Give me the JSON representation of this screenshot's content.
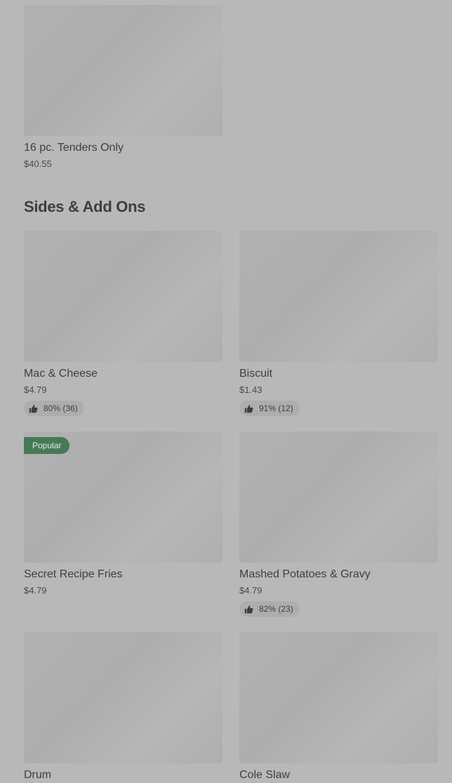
{
  "sections": [
    {
      "title": "",
      "items": [
        {
          "name": "16 pc. Tenders Only",
          "price": "$40.55",
          "rating": "",
          "badge": ""
        }
      ]
    },
    {
      "title": "Sides & Add Ons",
      "items": [
        {
          "name": "Mac & Cheese",
          "price": "$4.79",
          "rating": "80% (36)",
          "badge": ""
        },
        {
          "name": "Biscuit",
          "price": "$1.43",
          "rating": "91% (12)",
          "badge": ""
        },
        {
          "name": "Secret Recipe Fries",
          "price": "$4.79",
          "rating": "",
          "badge": "Popular"
        },
        {
          "name": "Mashed Potatoes & Gravy",
          "price": "$4.79",
          "rating": "82% (23)",
          "badge": ""
        },
        {
          "name": "Drum",
          "price": "",
          "rating": "",
          "badge": ""
        },
        {
          "name": "Cole Slaw",
          "price": "",
          "rating": "",
          "badge": ""
        }
      ]
    }
  ],
  "icons": {
    "rating": "thumbs-up-icon"
  },
  "colors": {
    "background": "#b8b8b8",
    "popular_badge": "#447a56",
    "text": "#3e3e3e"
  }
}
